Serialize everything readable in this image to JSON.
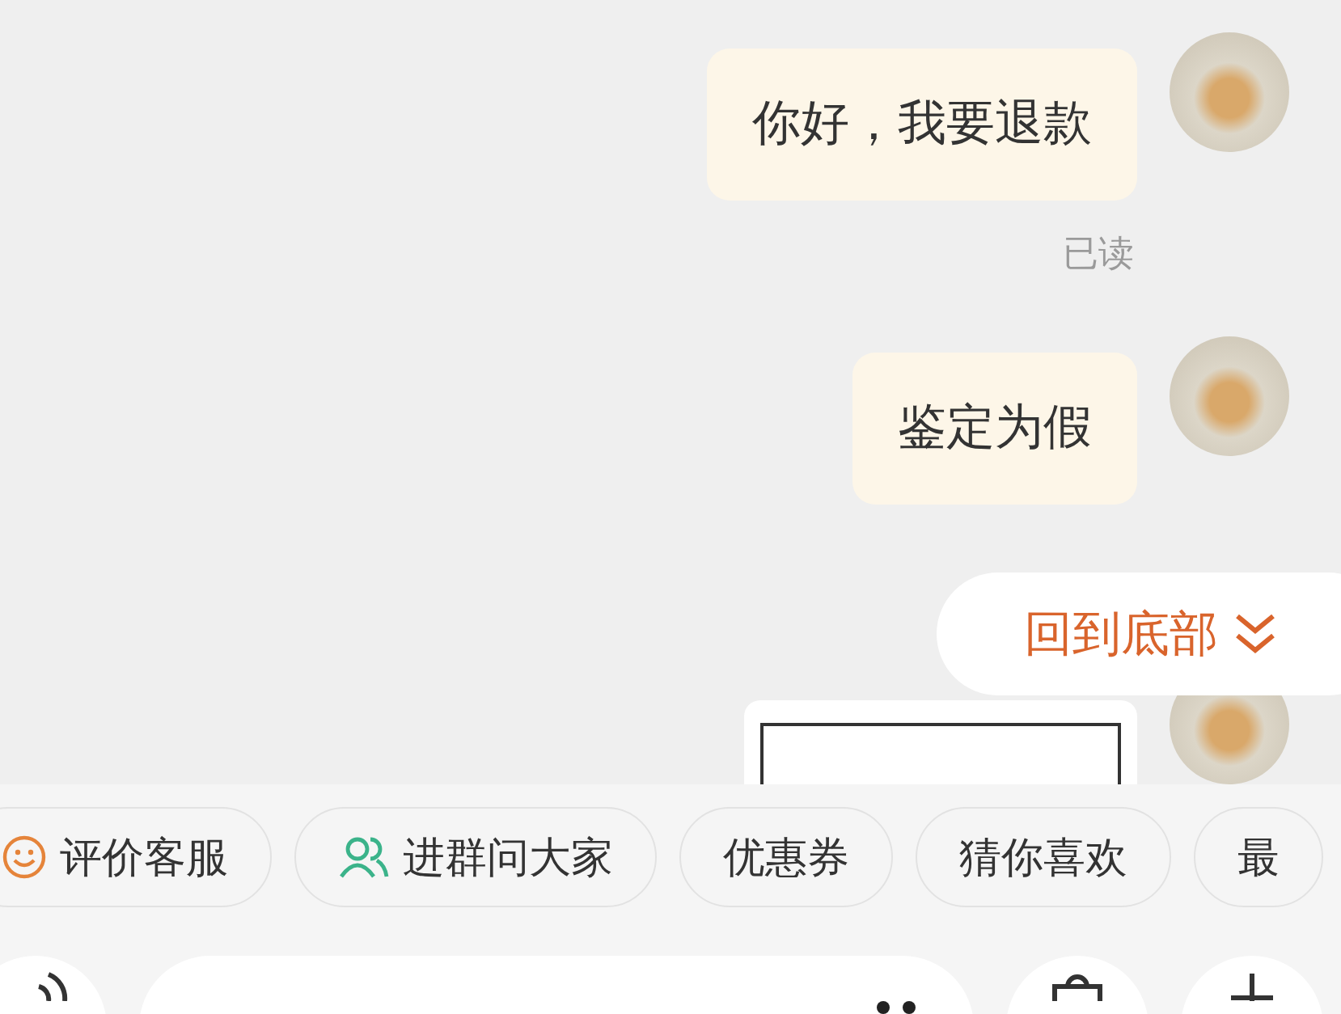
{
  "messages": [
    {
      "kind": "text",
      "text": "你好，我要退款",
      "status": "已读"
    },
    {
      "kind": "text",
      "text": "鉴定为假"
    },
    {
      "kind": "image"
    }
  ],
  "jump_button": {
    "label": "回到底部"
  },
  "quick_actions": [
    {
      "kind": "smiley",
      "label": "评价客服"
    },
    {
      "kind": "group",
      "label": "进群问大家"
    },
    {
      "kind": "plain",
      "label": "优惠券"
    },
    {
      "kind": "plain",
      "label": "猜你喜欢"
    },
    {
      "kind": "plain",
      "label": "最"
    }
  ]
}
